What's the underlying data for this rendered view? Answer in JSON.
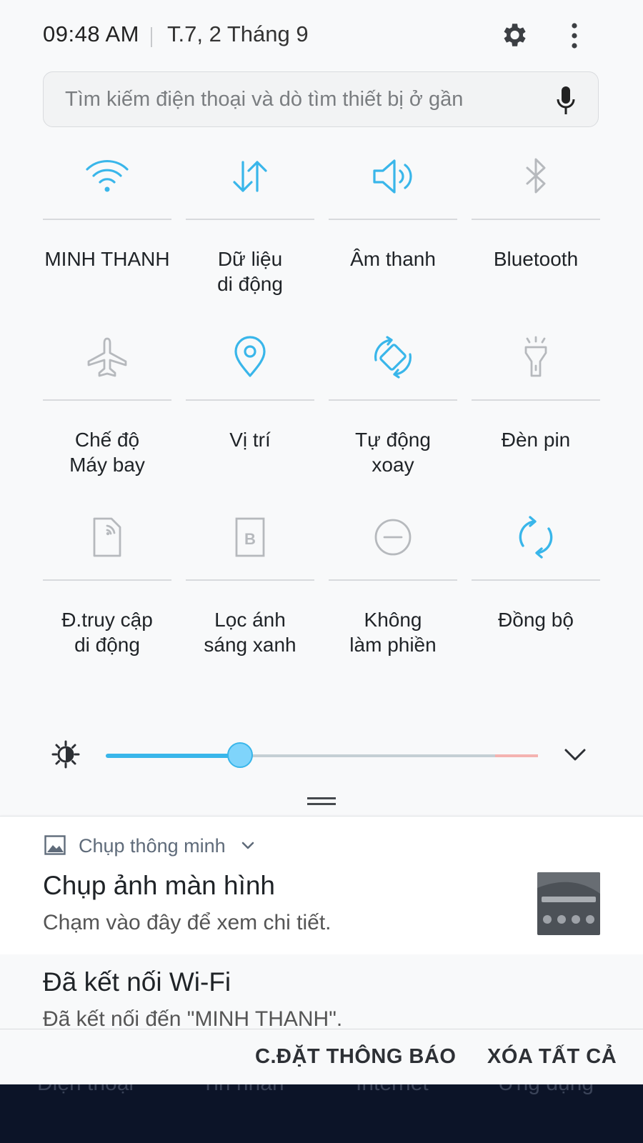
{
  "status_bar": {
    "time": "09:48 AM",
    "date": "T.7, 2 Tháng 9"
  },
  "search": {
    "placeholder": "Tìm kiếm điện thoại và dò tìm thiết bị ở gần"
  },
  "colors": {
    "accent": "#39b6ea",
    "inactive": "#b6b9bd",
    "warning": "#f4b3b0",
    "dock": "#0c1428"
  },
  "tiles": [
    {
      "label": "MINH THANH",
      "icon": "wifi-icon",
      "active": true
    },
    {
      "label": "Dữ liệu\ndi động",
      "icon": "mobile-data-icon",
      "active": true
    },
    {
      "label": "Âm thanh",
      "icon": "sound-icon",
      "active": true
    },
    {
      "label": "Bluetooth",
      "icon": "bluetooth-icon",
      "active": false
    },
    {
      "label": "Chế độ\nMáy bay",
      "icon": "airplane-icon",
      "active": false
    },
    {
      "label": "Vị trí",
      "icon": "location-icon",
      "active": true
    },
    {
      "label": "Tự động\nxoay",
      "icon": "auto-rotate-icon",
      "active": true
    },
    {
      "label": "Đèn pin",
      "icon": "flashlight-icon",
      "active": false
    },
    {
      "label": "Đ.truy cập\ndi động",
      "icon": "mobile-hotspot-icon",
      "active": false
    },
    {
      "label": "Lọc ánh\nsáng xanh",
      "icon": "blue-light-filter-icon",
      "active": false
    },
    {
      "label": "Không\nlàm phiền",
      "icon": "do-not-disturb-icon",
      "active": false
    },
    {
      "label": "Đồng bộ",
      "icon": "sync-icon",
      "active": true
    }
  ],
  "brightness": {
    "level": 0.31,
    "warning_from": 0.9
  },
  "notifications": [
    {
      "app_name": "Chụp thông minh",
      "title": "Chụp ảnh màn hình",
      "text": "Chạm vào đây để xem chi tiết."
    },
    {
      "title": "Đã kết nối Wi-Fi",
      "text": "Đã kết nối đến \"MINH THANH\"."
    }
  ],
  "actions": {
    "settings": "C.ĐẶT THÔNG BÁO",
    "clear_all": "XÓA TẤT CẢ"
  },
  "dock_labels": [
    "Điện thoại",
    "Tin nhắn",
    "Internet",
    "Ứng dụng"
  ]
}
